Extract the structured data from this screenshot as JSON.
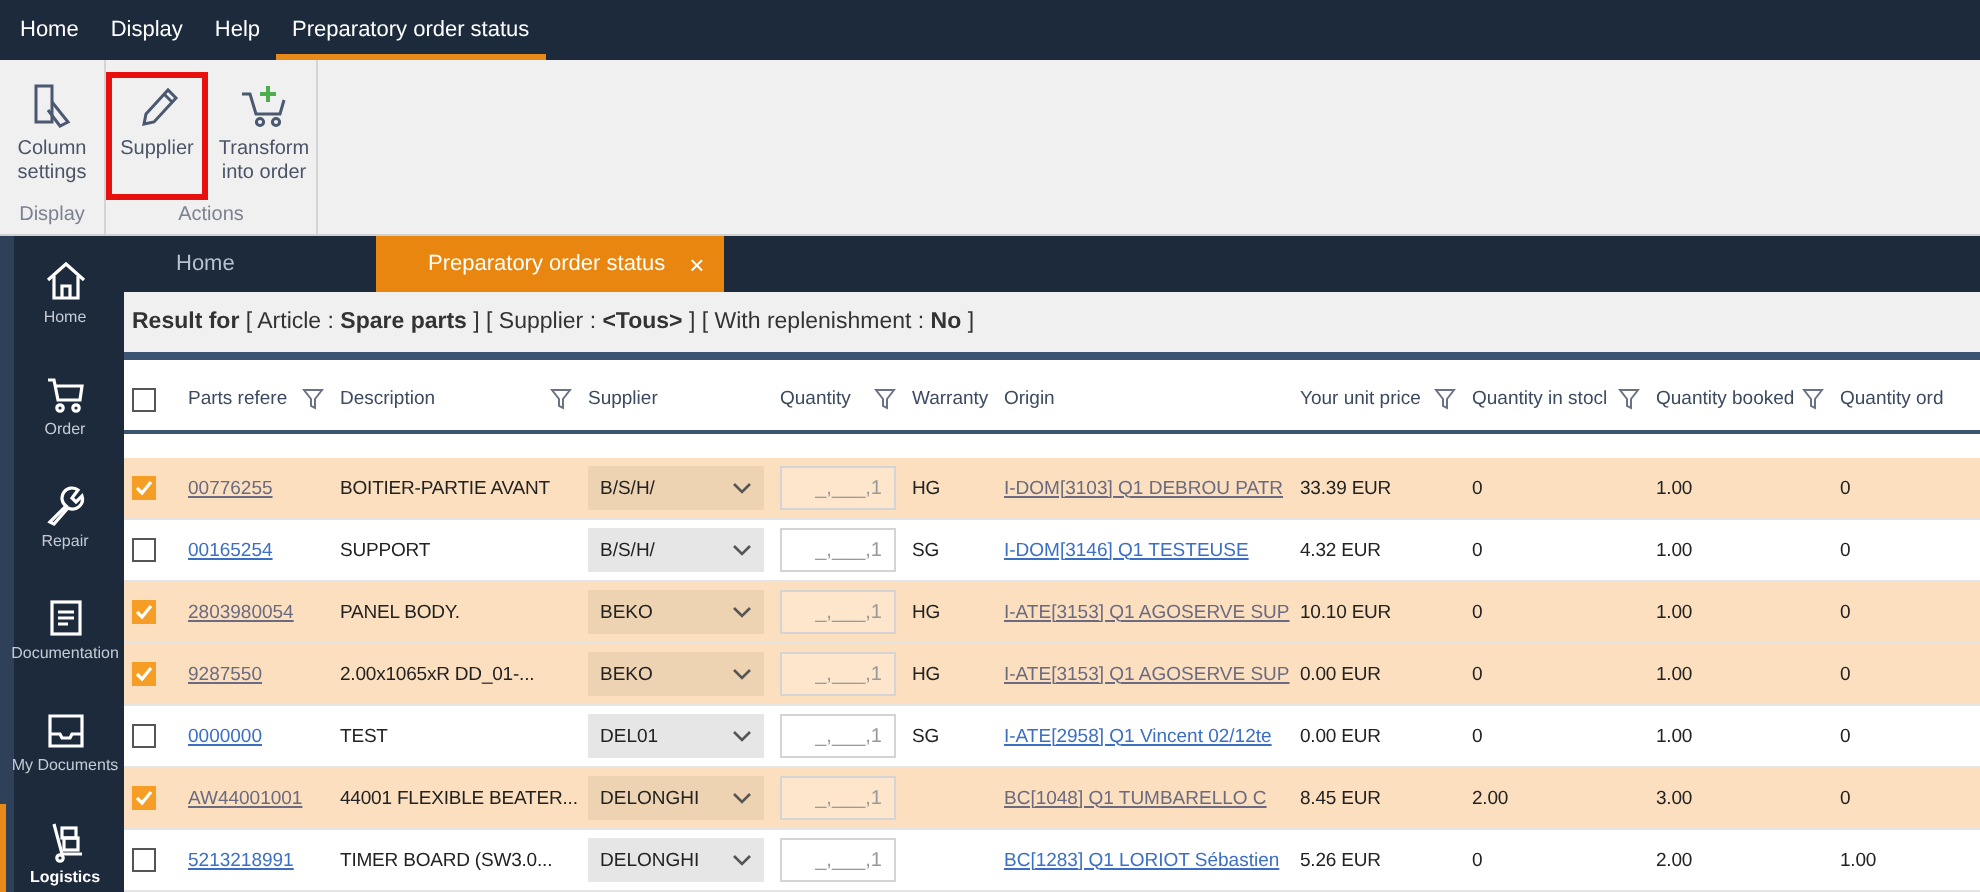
{
  "menu": [
    {
      "label": "Home",
      "selected": false
    },
    {
      "label": "Display",
      "selected": false
    },
    {
      "label": "Help",
      "selected": false
    },
    {
      "label": "Preparatory order status",
      "selected": true
    }
  ],
  "ribbon": {
    "groups": [
      {
        "label": "Display",
        "buttons": [
          {
            "label": "Column settings",
            "highlighted": false
          }
        ]
      },
      {
        "label": "Actions",
        "buttons": [
          {
            "label": "Supplier",
            "highlighted": true
          },
          {
            "label": "Transform into order",
            "highlighted": false
          }
        ]
      }
    ]
  },
  "sidebar": [
    {
      "label": "Home",
      "selected": false
    },
    {
      "label": "Order",
      "selected": false
    },
    {
      "label": "Repair",
      "selected": false
    },
    {
      "label": "Documentation",
      "selected": false
    },
    {
      "label": "My Documents",
      "selected": false
    },
    {
      "label": "Logistics",
      "selected": true
    }
  ],
  "tabs": [
    {
      "label": "Home",
      "selected": false
    },
    {
      "label": "Preparatory order status",
      "selected": true,
      "close": "×"
    }
  ],
  "filter_summary": "**Result for**  [ Article : **Spare parts** ]  [ Supplier : **<Tous>** ]  [ With replenishment : **No** ]",
  "table": {
    "select_all": {
      "checked": false
    },
    "columns": [
      {
        "label": "Parts refere",
        "filter": true
      },
      {
        "label": "Description",
        "filter": true
      },
      {
        "label": "Supplier",
        "filter": false
      },
      {
        "label": "Quantity",
        "filter": true
      },
      {
        "label": "Warranty",
        "filter": false
      },
      {
        "label": "Origin",
        "filter": false
      },
      {
        "label": "Your unit price",
        "filter": true
      },
      {
        "label": "Quantity in stocl",
        "filter": true
      },
      {
        "label": "Quantity booked",
        "filter": true
      },
      {
        "label": "Quantity ord",
        "filter": false
      }
    ],
    "rows": [
      {
        "checked": true,
        "part_ref": "00776255",
        "description": "BOITIER-PARTIE AVANT",
        "supplier": "B/S/H/",
        "quantity": "_,___,1",
        "warranty": "HG",
        "origin": "I-DOM[3103] Q1 DEBROU PATR",
        "unit_price": "33.39 EUR",
        "in_stock": "0",
        "booked": "1.00",
        "ordered": "0"
      },
      {
        "checked": false,
        "part_ref": "00165254",
        "description": "SUPPORT",
        "supplier": "B/S/H/",
        "quantity": "_,___,1",
        "warranty": "SG",
        "origin": "I-DOM[3146] Q1 TESTEUSE",
        "unit_price": "4.32 EUR",
        "in_stock": "0",
        "booked": "1.00",
        "ordered": "0"
      },
      {
        "checked": true,
        "part_ref": "2803980054",
        "description": "PANEL BODY.",
        "supplier": "BEKO",
        "quantity": "_,___,1",
        "warranty": "HG",
        "origin": "I-ATE[3153] Q1 AGOSERVE SUP",
        "unit_price": "10.10 EUR",
        "in_stock": "0",
        "booked": "1.00",
        "ordered": "0"
      },
      {
        "checked": true,
        "part_ref": "9287550",
        "description": "2.00x1065xR DD_01-...",
        "supplier": "BEKO",
        "quantity": "_,___,1",
        "warranty": "HG",
        "origin": "I-ATE[3153] Q1 AGOSERVE SUP",
        "unit_price": "0.00 EUR",
        "in_stock": "0",
        "booked": "1.00",
        "ordered": "0"
      },
      {
        "checked": false,
        "part_ref": "0000000",
        "description": "TEST",
        "supplier": "DEL01",
        "quantity": "_,___,1",
        "warranty": "SG",
        "origin": "I-ATE[2958] Q1 Vincent 02/12te",
        "unit_price": "0.00 EUR",
        "in_stock": "0",
        "booked": "1.00",
        "ordered": "0"
      },
      {
        "checked": true,
        "part_ref": "AW44001001",
        "description": "44001 FLEXIBLE BEATER...",
        "supplier": "DELONGHI",
        "quantity": "_,___,1",
        "origin": "BC[1048] Q1 TUMBARELLO C",
        "unit_price": "8.45 EUR",
        "in_stock": "2.00",
        "booked": "3.00",
        "ordered": "0"
      },
      {
        "checked": false,
        "part_ref": "5213218991",
        "description": "TIMER BOARD (SW3.0...",
        "supplier": "DELONGHI",
        "quantity": "_,___,1",
        "origin": "BC[1283] Q1 LORIOT Sébastien",
        "unit_price": "5.26 EUR",
        "in_stock": "0",
        "booked": "2.00",
        "ordered": "1.00"
      }
    ]
  }
}
